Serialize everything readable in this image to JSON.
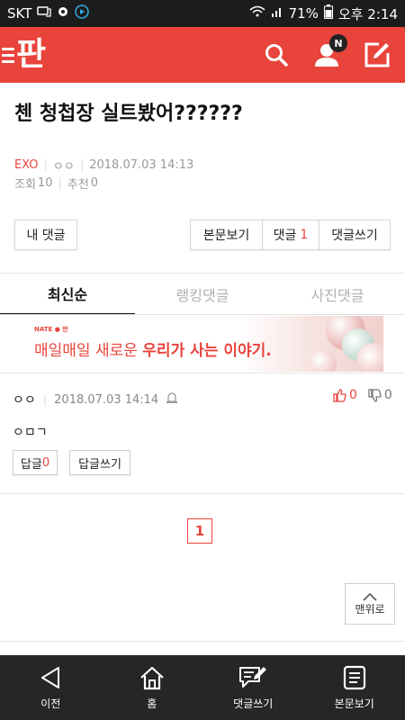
{
  "status_bar": {
    "carrier": "SKT",
    "carrier_icon": "talk-icon",
    "battery": "71%",
    "time": "오후 2:14"
  },
  "app_bar": {
    "logo": "판",
    "badge": "N",
    "accent": "#e8443b"
  },
  "post": {
    "title": "첸 청첩장 실트봤어??????",
    "category": "EXO",
    "author": "ㅇㅇ",
    "datetime": "2018.07.03 14:13",
    "views_label": "조회",
    "views": "10",
    "recommend_label": "추천",
    "recommend": "0"
  },
  "buttons": {
    "my_comment": "내 댓글",
    "view_body": "본문보기",
    "comments_label": "댓글",
    "comments_count": "1",
    "write_comment": "댓글쓰기"
  },
  "tabs": [
    {
      "label": "최신순",
      "active": true
    },
    {
      "label": "랭킹댓글",
      "active": false
    },
    {
      "label": "사진댓글",
      "active": false
    }
  ],
  "banner": {
    "brand": "NATE ● 판",
    "text_normal": "매일매일 새로운 ",
    "text_bold": "우리가 사는 이야기."
  },
  "comment": {
    "author": "ㅇㅇ",
    "datetime": "2018.07.03 14:14",
    "likes": "0",
    "dislikes": "0",
    "body": "ㅇㅁㄱ",
    "reply_label": "답글",
    "reply_count": "0",
    "reply_write": "답글쓰기"
  },
  "pagination": {
    "current": "1"
  },
  "to_top": "맨위로",
  "bottom_nav": [
    {
      "label": "이전",
      "icon": "back-icon"
    },
    {
      "label": "홈",
      "icon": "home-icon"
    },
    {
      "label": "댓글쓰기",
      "icon": "comment-write-icon"
    },
    {
      "label": "본문보기",
      "icon": "document-icon"
    }
  ]
}
